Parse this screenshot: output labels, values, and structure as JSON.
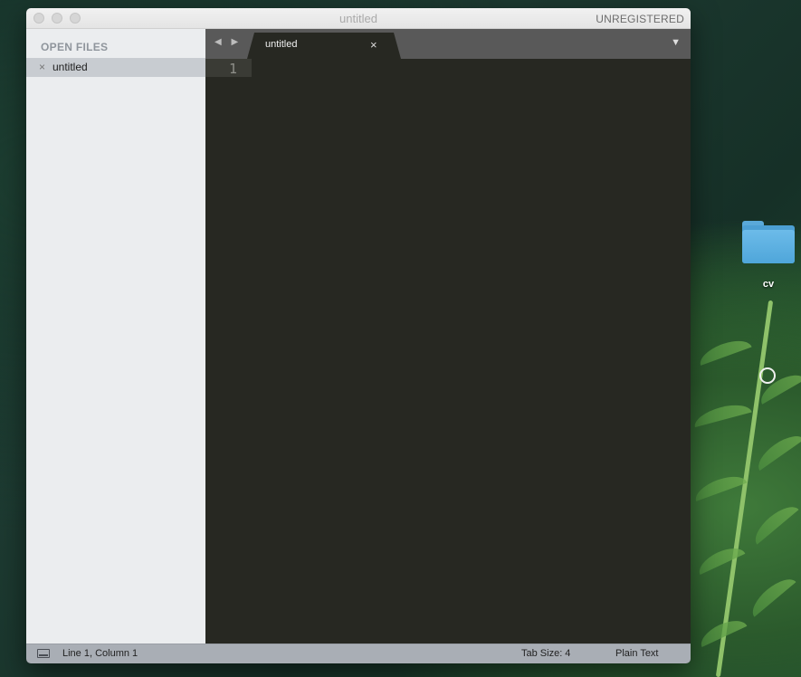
{
  "window": {
    "title": "untitled",
    "unregistered_label": "UNREGISTERED"
  },
  "sidebar": {
    "header": "OPEN FILES",
    "files": [
      {
        "close_glyph": "×",
        "name": "untitled"
      }
    ]
  },
  "tabbar": {
    "nav_arrows": "◀ ▶",
    "tabs": [
      {
        "label": "untitled",
        "close_glyph": "×"
      }
    ],
    "menu_glyph": "▼"
  },
  "editor": {
    "line_numbers": [
      "1"
    ]
  },
  "statusbar": {
    "position": "Line 1, Column 1",
    "tab_size": "Tab Size: 4",
    "syntax": "Plain Text"
  },
  "desktop": {
    "folder_label": "cv"
  },
  "colors": {
    "editor_bg": "#272822",
    "tabbar_bg": "#595959",
    "sidebar_bg": "#ebedef",
    "statusbar_bg": "#a9aeb5",
    "folder_blue": "#4fa6da"
  }
}
